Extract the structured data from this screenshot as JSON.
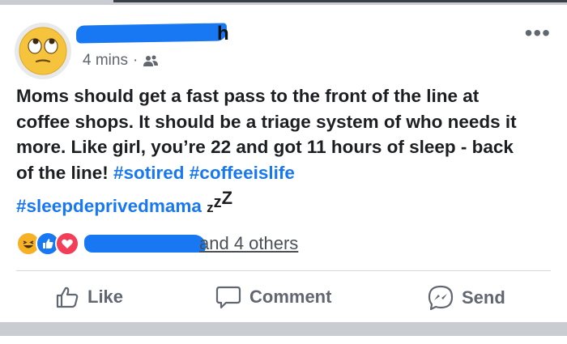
{
  "post": {
    "timestamp": "4 mins",
    "separator": "·",
    "name_visible_tail": "h",
    "text_part1": "Moms should get a fast pass to the front of the line at coffee shops. It should be a triage system of who needs it more. Like girl, you’re 22 and got 11 hours of sleep - back of the line! ",
    "hashtags": [
      "#sotired",
      "#coffeeislife",
      "#sleepdeprivedmama"
    ],
    "zzz": "zzz"
  },
  "reactions": {
    "types": [
      "haha",
      "like",
      "love"
    ],
    "summary_text": "and 4 others"
  },
  "actions": {
    "like_label": "Like",
    "comment_label": "Comment",
    "send_label": "Send"
  },
  "colors": {
    "link_blue": "#1877f2",
    "text": "#1c1e21",
    "muted": "#606770"
  },
  "icons": {
    "avatar": "rolling-eyes-emoji-icon",
    "audience": "friends-icon",
    "more": "more-options-icon"
  }
}
